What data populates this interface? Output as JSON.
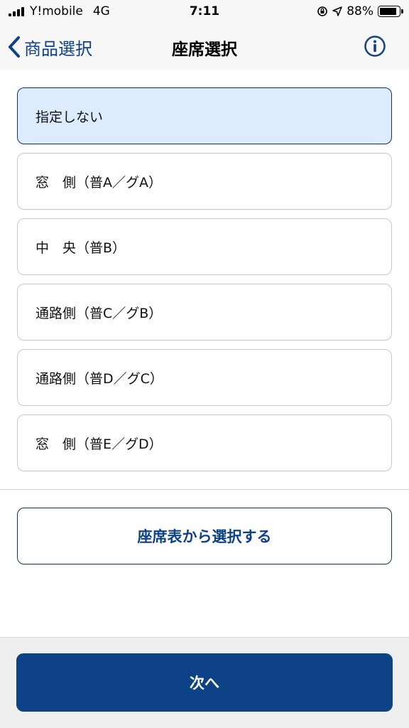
{
  "status_bar": {
    "carrier": "Y!mobile",
    "network": "4G",
    "time": "7:11",
    "battery_percent_text": "88%",
    "battery_level": 0.88
  },
  "nav": {
    "back_label": "商品選択",
    "title": "座席選択",
    "back_icon": "chevron-left-icon",
    "info_icon": "info-circle-icon"
  },
  "options": [
    {
      "label": "指定しない",
      "selected": true
    },
    {
      "label": "窓　側（普A／グA）",
      "selected": false
    },
    {
      "label": "中　央（普B）",
      "selected": false
    },
    {
      "label": "通路側（普C／グB）",
      "selected": false
    },
    {
      "label": "通路側（普D／グC）",
      "selected": false
    },
    {
      "label": "窓　側（普E／グD）",
      "selected": false
    }
  ],
  "seat_map_button": "座席表から選択する",
  "next_button": "次へ",
  "colors": {
    "accent": "#0e4287",
    "selected_bg": "#dcecfc",
    "selected_border": "#0e2f6e",
    "bar_bg": "#f7f7f7"
  }
}
